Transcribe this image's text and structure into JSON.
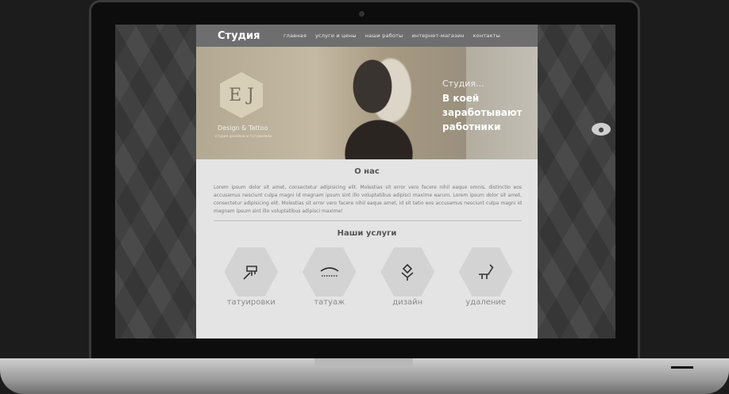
{
  "site": {
    "brand": "Студия",
    "nav": [
      "главная",
      "услуги и цены",
      "наши работы",
      "интернет-магазин",
      "контакты"
    ]
  },
  "hero": {
    "logo_mark": "E J",
    "logo_text": "Design & Tattoo",
    "logo_sub": "студия дизайна и татуировки",
    "kicker": "Студия...",
    "title": "В коей заработывают работники"
  },
  "about": {
    "title": "О нас",
    "text": "Lorem ipsum dolor sit amet, consectetur adipisicing elit. Molestias sit error vero facere nihil eaque omnis, distinctio eos accusamus nesciunt culpa magni id magnam ipsum sint illo voluptatibus adipisci maxime earum. Lorem ipsum dolor sit amet, consectetur adipisicing elit. Molestias sit error vero facere nihil eaque amet, id sit tatio eos accusamus nesciunt culpa magni id magnam ipsum sint illo voluptatibus adipisci maxime!"
  },
  "services": {
    "title": "Наши услуги",
    "items": [
      {
        "label": "татуировки",
        "icon": "tattoo-machine-icon"
      },
      {
        "label": "татуаж",
        "icon": "eyebrow-icon"
      },
      {
        "label": "дизайн",
        "icon": "flower-icon"
      },
      {
        "label": "удаление",
        "icon": "dental-chair-icon"
      }
    ]
  }
}
